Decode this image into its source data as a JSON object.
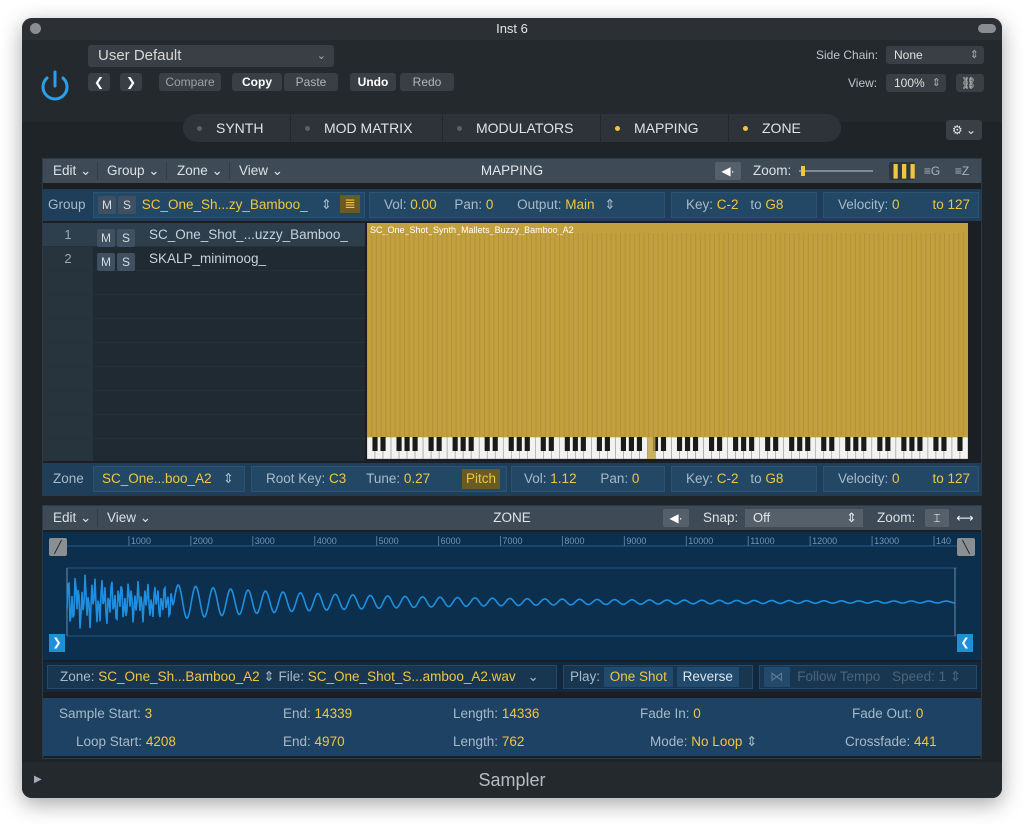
{
  "window": {
    "title": "Inst 6"
  },
  "header": {
    "preset": "User Default",
    "compare": "Compare",
    "copy": "Copy",
    "paste": "Paste",
    "undo": "Undo",
    "redo": "Redo",
    "side_chain_label": "Side Chain:",
    "side_chain_value": "None",
    "view_label": "View:",
    "view_value": "100%"
  },
  "tabs": [
    {
      "label": "SYNTH",
      "active": false
    },
    {
      "label": "MOD MATRIX",
      "active": false
    },
    {
      "label": "MODULATORS",
      "active": false
    },
    {
      "label": "MAPPING",
      "active": true
    },
    {
      "label": "ZONE",
      "active": true
    }
  ],
  "mapping": {
    "menus": [
      "Edit",
      "Group",
      "Zone",
      "View"
    ],
    "title": "MAPPING",
    "zoom_label": "Zoom:",
    "group_row": {
      "label": "Group",
      "m": "M",
      "s": "S",
      "name": "SC_One_Sh...zy_Bamboo_",
      "vol_label": "Vol:",
      "vol": "0.00",
      "pan_label": "Pan:",
      "pan": "0",
      "output_label": "Output:",
      "output": "Main",
      "key_label": "Key:",
      "key_low": "C-2",
      "to": "to",
      "key_high": "G8",
      "vel_label": "Velocity:",
      "vel_low": "0",
      "vel_high": "to 127"
    },
    "groups": [
      {
        "num": "1",
        "m": "M",
        "s": "S",
        "name": "SC_One_Shot_...uzzy_Bamboo_"
      },
      {
        "num": "2",
        "m": "M",
        "s": "S",
        "name": "SKALP_minimoog_"
      }
    ],
    "zone_label_on_map": "SC_One_Shot_Synth_Mallets_Buzzy_Bamboo_A2",
    "zone_row": {
      "label": "Zone",
      "name": "SC_One...boo_A2",
      "root_label": "Root Key:",
      "root": "C3",
      "tune_label": "Tune:",
      "tune": "0.27",
      "pitch": "Pitch",
      "vol_label": "Vol:",
      "vol": "1.12",
      "pan_label": "Pan:",
      "pan": "0",
      "key_label": "Key:",
      "key_low": "C-2",
      "to": "to",
      "key_high": "G8",
      "vel_label": "Velocity:",
      "vel_low": "0",
      "vel_high": "to 127"
    }
  },
  "zone": {
    "menus": [
      "Edit",
      "View"
    ],
    "title": "ZONE",
    "snap_label": "Snap:",
    "snap_value": "Off",
    "zoom_label": "Zoom:",
    "ruler": [
      "1000",
      "2000",
      "3000",
      "4000",
      "5000",
      "6000",
      "7000",
      "8000",
      "9000",
      "10000",
      "11000",
      "12000",
      "13000",
      "140"
    ],
    "info": {
      "zone_label": "Zone:",
      "zone_name": "SC_One_Sh...Bamboo_A2",
      "file_label": "File:",
      "file_name": "SC_One_Shot_S...amboo_A2.wav",
      "play_label": "Play:",
      "one_shot": "One Shot",
      "reverse": "Reverse",
      "follow_tempo": "Follow Tempo",
      "speed_label": "Speed:",
      "speed": "1"
    },
    "params": {
      "sample_start_label": "Sample Start:",
      "sample_start": "3",
      "end_label": "End:",
      "end": "14339",
      "length_label": "Length:",
      "length": "14336",
      "fade_in_label": "Fade In:",
      "fade_in": "0",
      "fade_out_label": "Fade Out:",
      "fade_out": "0",
      "loop_start_label": "Loop Start:",
      "loop_start": "4208",
      "loop_end_label": "End:",
      "loop_end": "4970",
      "loop_length_label": "Length:",
      "loop_length": "762",
      "mode_label": "Mode:",
      "mode": "No Loop",
      "crossfade_label": "Crossfade:",
      "crossfade": "441"
    }
  },
  "footer": {
    "title": "Sampler"
  },
  "colors": {
    "accent": "#f0c640",
    "zone_fill": "#c2a03e",
    "wave": "#1e8fe0",
    "active_blue": "#1f8fd8"
  }
}
